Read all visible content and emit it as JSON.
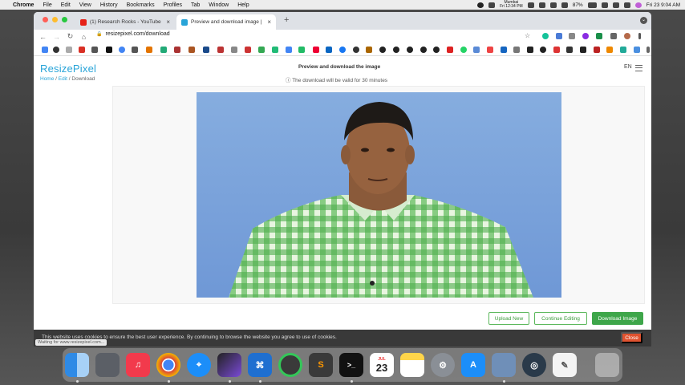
{
  "menubar": {
    "app": "Chrome",
    "menus": [
      "File",
      "Edit",
      "View",
      "History",
      "Bookmarks",
      "Profiles",
      "Tab",
      "Window",
      "Help"
    ],
    "clock_city": "Mumbai",
    "clock_time": "Fri 12:34 PM",
    "battery": "87%",
    "datetime": "Fri 23 9:04 AM"
  },
  "tabs": [
    {
      "title": "(1) Research Rocks - YouTube",
      "active": false
    },
    {
      "title": "Preview and download image |",
      "active": true
    }
  ],
  "address": {
    "url": "resizepixel.com/download"
  },
  "page": {
    "brand": "ResizePixel",
    "crumb_home": "Home",
    "crumb_sep1": " / ",
    "crumb_edit": "Edit",
    "crumb_sep2": " / ",
    "crumb_current": "Download",
    "title": "Preview and download the image",
    "validity": "ⓘ The download will be valid for 30 minutes",
    "lang": "EN",
    "buttons": {
      "upload": "Upload New",
      "continue": "Continue Editing",
      "download": "Download Image"
    }
  },
  "cookie": {
    "text": "This website uses cookies to ensure the best user experience. By continuing to browse the website you agree to use of cookies.",
    "close": "Close",
    "status": "Waiting for www.resizepixel.com..."
  },
  "dock": {
    "calendar_month": "JUL",
    "calendar_day": "23"
  },
  "colors": {
    "brand": "#28a4d8",
    "primary_button": "#3ea64a",
    "close_button": "#e0522f",
    "photo_background": "#7fa6df"
  }
}
